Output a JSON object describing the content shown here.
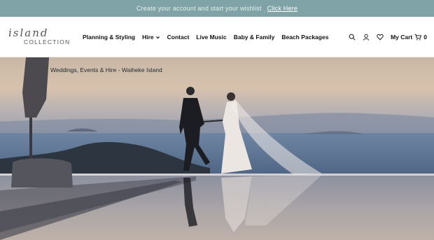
{
  "announcement": {
    "text": "Create your account and start your wishlist",
    "link_label": "Click Here",
    "bg_color": "#7fa3a6"
  },
  "logo": {
    "script": "island",
    "caps": "COLLECTION"
  },
  "nav": {
    "items": [
      {
        "label": "Planning & Styling",
        "has_dropdown": false
      },
      {
        "label": "Hire",
        "has_dropdown": true
      },
      {
        "label": "Contact",
        "has_dropdown": false
      },
      {
        "label": "Live Music",
        "has_dropdown": false
      },
      {
        "label": "Baby & Family",
        "has_dropdown": false
      },
      {
        "label": "Beach Packages",
        "has_dropdown": false
      }
    ]
  },
  "tools": {
    "search_icon": "search-icon",
    "account_icon": "user-icon",
    "wishlist_icon": "heart-icon",
    "cart_label": "My Cart",
    "cart_icon": "cart-icon",
    "cart_count": "0"
  },
  "hero": {
    "caption": "Weddings, Events & Hire - Waiheke Island"
  }
}
